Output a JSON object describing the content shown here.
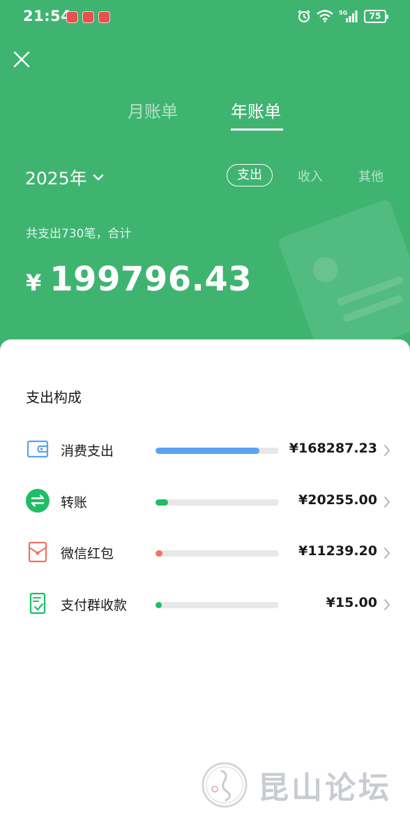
{
  "status_bar": {
    "time": "21:54",
    "network": "5G",
    "battery": "75"
  },
  "header": {
    "tabs": [
      {
        "label": "月账单",
        "active": false
      },
      {
        "label": "年账单",
        "active": true
      }
    ],
    "year": "2025年",
    "type_tabs": [
      {
        "label": "支出",
        "active": true
      },
      {
        "label": "收入",
        "active": false
      },
      {
        "label": "其他",
        "active": false
      }
    ],
    "summary": "共支出730笔，合计",
    "currency": "¥",
    "total": "199796.43"
  },
  "breakdown": {
    "title": "支出构成",
    "items": [
      {
        "icon": "wallet-icon",
        "label": "消费支出",
        "amount": "¥168287.23",
        "share": 0.842,
        "color": "#5aa3f0"
      },
      {
        "icon": "transfer-icon",
        "label": "转账",
        "amount": "¥20255.00",
        "share": 0.101,
        "color": "#1fbd67"
      },
      {
        "icon": "red-packet-icon",
        "label": "微信红包",
        "amount": "¥11239.20",
        "share": 0.056,
        "color": "#f0735a"
      },
      {
        "icon": "group-receipt-icon",
        "label": "支付群收款",
        "amount": "¥15.00",
        "share": 0.0001,
        "color": "#1fbd67"
      }
    ]
  },
  "watermark": {
    "text": "昆山论坛"
  },
  "colors": {
    "header_bg": "#3fb471",
    "card_bg": "#ffffff"
  }
}
